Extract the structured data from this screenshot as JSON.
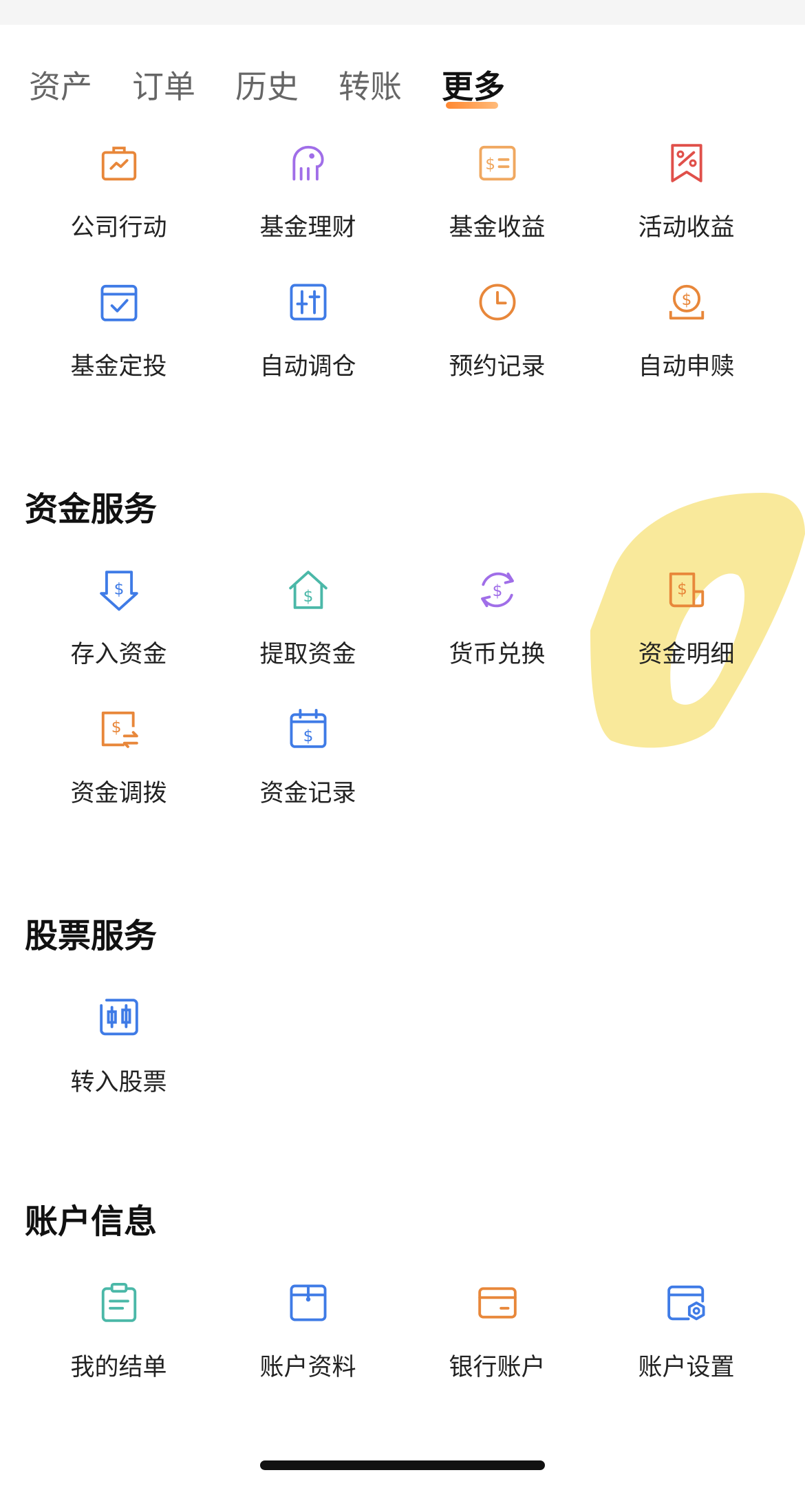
{
  "tabs": [
    {
      "label": "资产"
    },
    {
      "label": "订单"
    },
    {
      "label": "历史"
    },
    {
      "label": "转账"
    },
    {
      "label": "更多",
      "active": true
    }
  ],
  "top_grid": [
    {
      "label": "公司行动",
      "icon": "briefcase-chart-icon",
      "color": "#E8873A"
    },
    {
      "label": "基金理财",
      "icon": "elephant-icon",
      "color": "#A06EE8"
    },
    {
      "label": "基金收益",
      "icon": "dollar-ticket-icon",
      "color": "#F0A860"
    },
    {
      "label": "活动收益",
      "icon": "percent-ribbon-icon",
      "color": "#E0504A"
    },
    {
      "label": "基金定投",
      "icon": "calendar-check-icon",
      "color": "#3F7BE6"
    },
    {
      "label": "自动调仓",
      "icon": "sliders-icon",
      "color": "#3F7BE6"
    },
    {
      "label": "预约记录",
      "icon": "clock-icon",
      "color": "#E8873A"
    },
    {
      "label": "自动申赎",
      "icon": "coin-tray-icon",
      "color": "#E8873A"
    }
  ],
  "sections": {
    "funds": {
      "title": "资金服务",
      "items": [
        {
          "label": "存入资金",
          "icon": "deposit-arrow-icon",
          "color": "#3F7BE6"
        },
        {
          "label": "提取资金",
          "icon": "withdraw-house-icon",
          "color": "#4BB8A8"
        },
        {
          "label": "货币兑换",
          "icon": "currency-exchange-icon",
          "color": "#A06EE8"
        },
        {
          "label": "资金明细",
          "icon": "fund-detail-doc-icon",
          "color": "#E8873A"
        },
        {
          "label": "资金调拨",
          "icon": "fund-transfer-icon",
          "color": "#E8873A"
        },
        {
          "label": "资金记录",
          "icon": "fund-calendar-icon",
          "color": "#3F7BE6"
        }
      ]
    },
    "stocks": {
      "title": "股票服务",
      "items": [
        {
          "label": "转入股票",
          "icon": "candlestick-icon",
          "color": "#3F7BE6"
        }
      ]
    },
    "account": {
      "title": "账户信息",
      "items": [
        {
          "label": "我的结单",
          "icon": "clipboard-icon",
          "color": "#4BB8A8"
        },
        {
          "label": "账户资料",
          "icon": "folder-doc-icon",
          "color": "#3F7BE6"
        },
        {
          "label": "银行账户",
          "icon": "bank-card-icon",
          "color": "#E8873A"
        },
        {
          "label": "账户设置",
          "icon": "settings-window-icon",
          "color": "#3F7BE6"
        }
      ]
    }
  },
  "highlight_color": "#F7E27A"
}
